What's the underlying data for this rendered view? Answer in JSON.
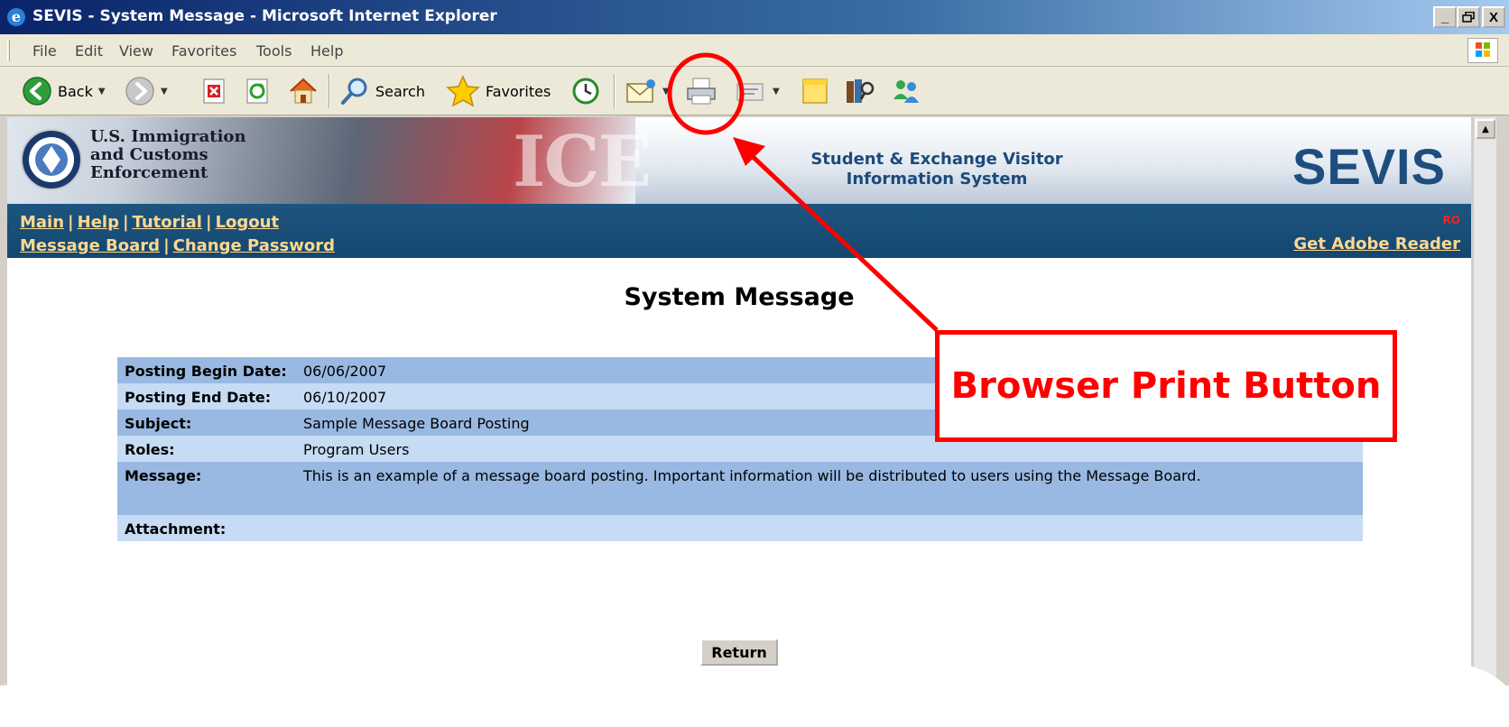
{
  "window": {
    "title": "SEVIS - System Message - Microsoft Internet Explorer",
    "minimize": "_",
    "restore": " ",
    "close": "X"
  },
  "menu": {
    "items": [
      "File",
      "Edit",
      "View",
      "Favorites",
      "Tools",
      "Help"
    ]
  },
  "toolbar": {
    "back_label": "Back",
    "search_label": "Search",
    "favorites_label": "Favorites"
  },
  "header": {
    "org_lines": [
      "U.S. Immigration",
      "and Customs",
      "Enforcement"
    ],
    "ice_text": "ICE",
    "system_name_lines": [
      "Student & Exchange Visitor",
      "Information System"
    ],
    "sevis_logo": "SEVIS"
  },
  "nav": {
    "row1": [
      "Main",
      "Help",
      "Tutorial",
      "Logout"
    ],
    "row2": [
      "Message Board",
      "Change Password"
    ],
    "separator": "|",
    "badge": "RO",
    "adobe": "Get Adobe Reader"
  },
  "page": {
    "title": "System Message",
    "return_label": "Return"
  },
  "message": {
    "rows": [
      {
        "label": "Posting Begin Date:",
        "value": "06/06/2007"
      },
      {
        "label": "Posting End Date:",
        "value": "06/10/2007"
      },
      {
        "label": "Subject:",
        "value": "Sample Message Board Posting"
      },
      {
        "label": "Roles:",
        "value": "Program Users"
      },
      {
        "label": "Message:",
        "value": "This is an example of a message board posting.  Important information will be distributed to users using the Message Board."
      },
      {
        "label": "Attachment:",
        "value": ""
      }
    ]
  },
  "annotation": {
    "callout": "Browser Print Button",
    "color": "#ff0000"
  },
  "colors": {
    "nav_bg": "#14476f",
    "nav_link": "#ffd890",
    "row_dark": "#99b9e2",
    "row_light": "#c6dbf4",
    "sevis_blue": "#1e4e80"
  }
}
